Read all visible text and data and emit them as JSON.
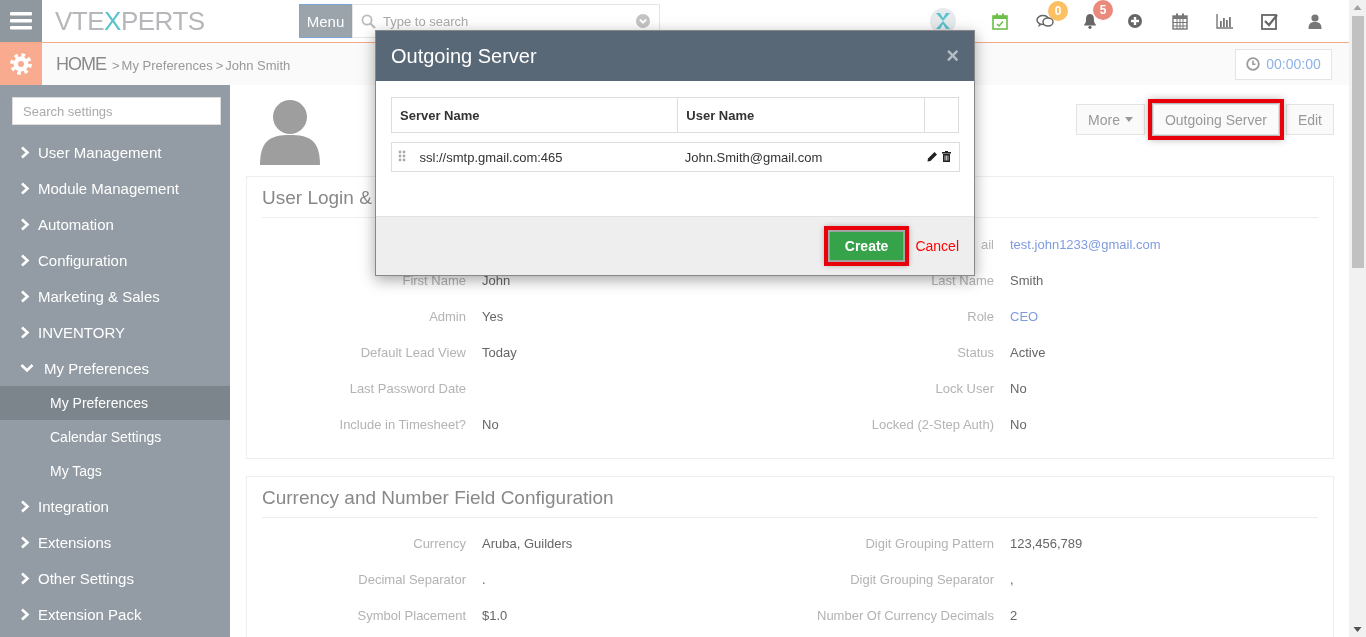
{
  "header": {
    "logo": {
      "lead": "VTE",
      "accent": "X",
      "tail": "PERTS"
    },
    "menu_button": "Menu",
    "search": {
      "placeholder": "Type to search"
    },
    "icons": [
      {
        "kind": "brand"
      },
      {
        "kind": "calendar-check"
      },
      {
        "kind": "chat",
        "badge": "0",
        "color": "#fcbf62"
      },
      {
        "kind": "bell",
        "badge": "5",
        "color": "#ea8a7c"
      },
      {
        "kind": "plus"
      },
      {
        "kind": "calendar"
      },
      {
        "kind": "chart"
      },
      {
        "kind": "checkbox"
      },
      {
        "kind": "user"
      }
    ]
  },
  "breadcrumb": {
    "home": "HOME",
    "items": [
      {
        "sep": ">",
        "label": "My Preferences"
      },
      {
        "sep": ">",
        "label": "John Smith"
      }
    ]
  },
  "timer": "00:00:00",
  "sidebar": {
    "search": {
      "placeholder": "Search settings"
    },
    "items": [
      {
        "label": "User Management",
        "expanded": false
      },
      {
        "label": "Module Management",
        "expanded": false
      },
      {
        "label": "Automation",
        "expanded": false
      },
      {
        "label": "Configuration",
        "expanded": false
      },
      {
        "label": "Marketing & Sales",
        "expanded": false
      },
      {
        "label": "INVENTORY",
        "expanded": false
      },
      {
        "label": "My Preferences",
        "expanded": true,
        "children": [
          {
            "label": "My Preferences",
            "selected": true
          },
          {
            "label": "Calendar Settings",
            "selected": false
          },
          {
            "label": "My Tags",
            "selected": false
          }
        ]
      },
      {
        "label": "Integration",
        "expanded": false
      },
      {
        "label": "Extensions",
        "expanded": false
      },
      {
        "label": "Other Settings",
        "expanded": false
      },
      {
        "label": "Extension Pack",
        "expanded": false
      }
    ]
  },
  "actions": [
    {
      "label": "More",
      "kind": "dropdown",
      "highlighted": false
    },
    {
      "label": "Outgoing Server",
      "kind": "button",
      "highlighted": true
    },
    {
      "label": "Edit",
      "kind": "button",
      "highlighted": false
    }
  ],
  "sections": [
    {
      "title": "User Login &",
      "rows": [
        {
          "right": {
            "label": "ail",
            "value": "test.john1233@gmail.com",
            "link": true
          }
        },
        {
          "left": {
            "label": "First Name",
            "value": "John",
            "link": false
          },
          "right": {
            "label": "Last Name",
            "value": "Smith",
            "link": false
          }
        },
        {
          "left": {
            "label": "Admin",
            "value": "Yes",
            "link": false
          },
          "right": {
            "label": "Role",
            "value": "CEO",
            "link": true
          }
        },
        {
          "left": {
            "label": "Default Lead View",
            "value": "Today",
            "link": false
          },
          "right": {
            "label": "Status",
            "value": "Active",
            "link": false
          }
        },
        {
          "left": {
            "label": "Last Password Date"
          },
          "right": {
            "label": "Lock User",
            "value": "No",
            "link": false
          }
        },
        {
          "left": {
            "label": "Include in Timesheet?",
            "value": "No",
            "link": false
          },
          "right": {
            "label": "Locked (2-Step Auth)",
            "value": "No",
            "link": false
          }
        }
      ]
    },
    {
      "title": "Currency and Number Field Configuration",
      "rows": [
        {
          "left": {
            "label": "Currency",
            "value": "Aruba, Guilders",
            "link": false
          },
          "right": {
            "label": "Digit Grouping Pattern",
            "value": "123,456,789",
            "link": false
          }
        },
        {
          "left": {
            "label": "Decimal Separator",
            "value": ".",
            "link": false
          },
          "right": {
            "label": "Digit Grouping Separator",
            "value": ",",
            "link": false
          }
        },
        {
          "left": {
            "label": "Symbol Placement",
            "value": "$1.0",
            "link": false
          },
          "right": {
            "label": "Number Of Currency Decimals",
            "value": "2",
            "link": false
          }
        }
      ]
    }
  ],
  "modal": {
    "title": "Outgoing Server",
    "close": "×",
    "table": {
      "columns": [
        "Server Name",
        "User Name"
      ],
      "rows": [
        {
          "server": "ssl://smtp.gmail.com:465",
          "user": "John.Smith@gmail.com"
        }
      ]
    },
    "buttons": [
      {
        "label": "Create",
        "kind": "primary",
        "highlighted": true
      },
      {
        "label": "Cancel",
        "kind": "link",
        "highlighted": false
      }
    ]
  }
}
